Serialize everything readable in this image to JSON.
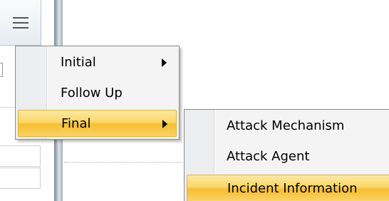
{
  "main_menu": {
    "items": [
      {
        "label": "Initial",
        "has_submenu": true,
        "highlighted": false
      },
      {
        "label": "Follow Up",
        "has_submenu": false,
        "highlighted": false
      },
      {
        "label": "Final",
        "has_submenu": true,
        "highlighted": true
      }
    ]
  },
  "final_submenu": {
    "items": [
      {
        "label": "Attack Mechanism",
        "highlighted": false
      },
      {
        "label": "Attack Agent",
        "highlighted": false
      },
      {
        "label": "Incident Information",
        "highlighted": true
      }
    ]
  },
  "icons": {
    "menu_button": "hamburger-icon",
    "submenu_indicator": "triangle-right-icon"
  },
  "colors": {
    "highlight_top": "#fde9a4",
    "highlight_bottom": "#f7be2f",
    "menu_background": "#f4f4f4",
    "splitter": "#a6afba"
  }
}
